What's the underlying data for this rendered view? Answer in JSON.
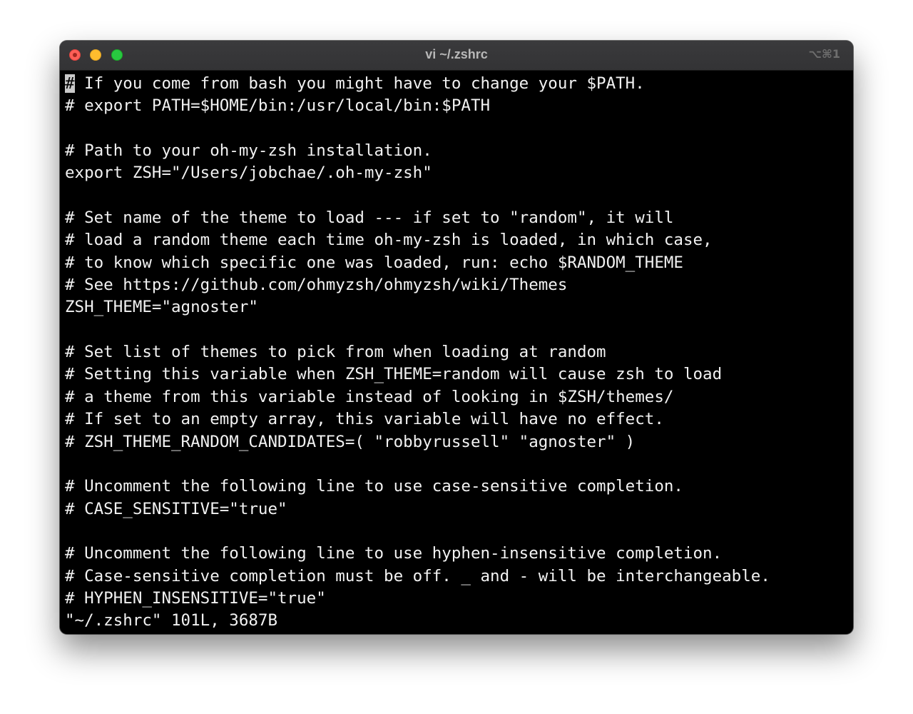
{
  "window": {
    "title": "vi ~/.zshrc",
    "shortcut": "⌥⌘1"
  },
  "editor": {
    "cursor_char": "#",
    "first_line_rest": " If you come from bash you might have to change your $PATH.",
    "lines": [
      "# export PATH=$HOME/bin:/usr/local/bin:$PATH",
      "",
      "# Path to your oh-my-zsh installation.",
      "export ZSH=\"/Users/jobchae/.oh-my-zsh\"",
      "",
      "# Set name of the theme to load --- if set to \"random\", it will",
      "# load a random theme each time oh-my-zsh is loaded, in which case,",
      "# to know which specific one was loaded, run: echo $RANDOM_THEME",
      "# See https://github.com/ohmyzsh/ohmyzsh/wiki/Themes",
      "ZSH_THEME=\"agnoster\"",
      "",
      "# Set list of themes to pick from when loading at random",
      "# Setting this variable when ZSH_THEME=random will cause zsh to load",
      "# a theme from this variable instead of looking in $ZSH/themes/",
      "# If set to an empty array, this variable will have no effect.",
      "# ZSH_THEME_RANDOM_CANDIDATES=( \"robbyrussell\" \"agnoster\" )",
      "",
      "# Uncomment the following line to use case-sensitive completion.",
      "# CASE_SENSITIVE=\"true\"",
      "",
      "# Uncomment the following line to use hyphen-insensitive completion.",
      "# Case-sensitive completion must be off. _ and - will be interchangeable.",
      "# HYPHEN_INSENSITIVE=\"true\""
    ],
    "status_line": "\"~/.zshrc\" 101L, 3687B"
  }
}
